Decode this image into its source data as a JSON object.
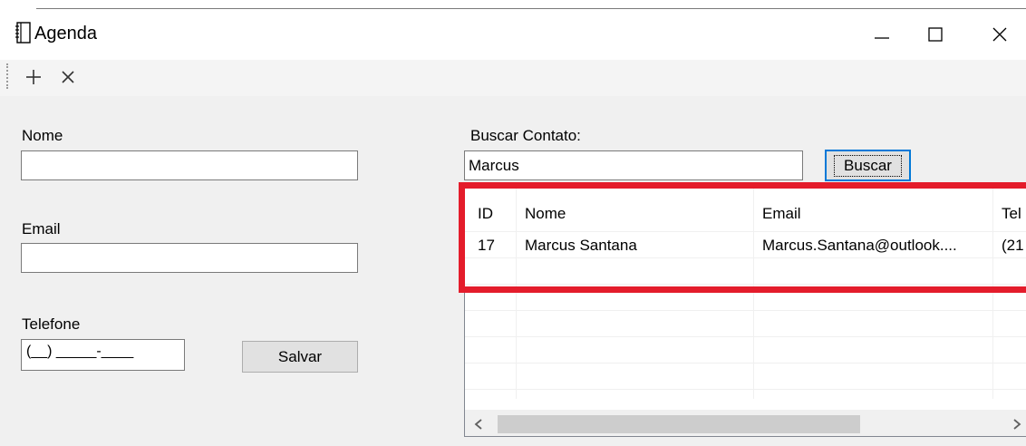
{
  "window": {
    "title": "Agenda",
    "icon": "notebook-icon",
    "controls": [
      "minimize-icon",
      "maximize-icon",
      "close-icon"
    ]
  },
  "toolbar": {
    "items": [
      "add-icon",
      "delete-icon"
    ]
  },
  "form": {
    "nome_label": "Nome",
    "nome_value": "",
    "email_label": "Email",
    "email_value": "",
    "telefone_label": "Telefone",
    "telefone_mask": "(__) _____-____",
    "save_label": "Salvar"
  },
  "search": {
    "label": "Buscar Contato:",
    "value": "Marcus",
    "button_label": "Buscar"
  },
  "grid": {
    "columns": [
      "ID",
      "Nome",
      "Email",
      "Tel"
    ],
    "rows": [
      [
        "17",
        "Marcus Santana",
        "Marcus.Santana@outlook....",
        "(21"
      ]
    ]
  },
  "colors": {
    "highlight": "#e41c2b",
    "focus": "#0078d7",
    "background": "#f0f0f0"
  }
}
